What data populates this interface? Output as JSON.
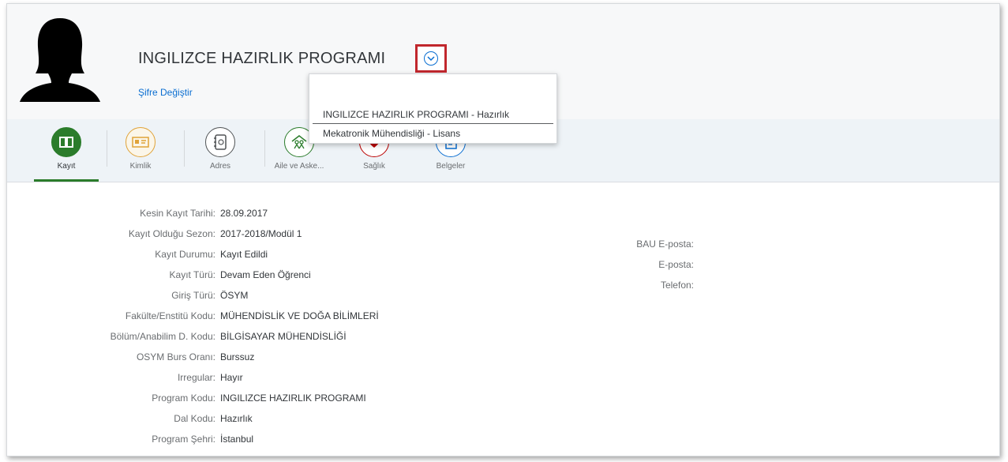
{
  "header": {
    "program_title": "INGILIZCE HAZIRLIK PROGRAMI",
    "change_password": "Şifre Değiştir"
  },
  "program_dropdown": {
    "items": [
      "INGILIZCE HAZIRLIK PROGRAMI - Hazırlık",
      "Mekatronik Mühendisliği - Lisans"
    ]
  },
  "tabs": [
    {
      "label": "Kayıt",
      "icon": "book-icon",
      "color": "#2b7c2b",
      "active": true
    },
    {
      "label": "Kimlik",
      "icon": "id-card-icon",
      "color": "#e0a339",
      "active": false
    },
    {
      "label": "Adres",
      "icon": "address-book-icon",
      "color": "#515456",
      "active": false
    },
    {
      "label": "Aile ve Aske...",
      "icon": "family-icon",
      "color": "#2b7c2b",
      "active": false
    },
    {
      "label": "Sağlık",
      "icon": "health-icon",
      "color": "#bb0000",
      "active": false
    },
    {
      "label": "Belgeler",
      "icon": "documents-icon",
      "color": "#0a6ed1",
      "active": false
    }
  ],
  "fields_left": [
    {
      "label": "Kesin Kayıt Tarihi:",
      "value": "28.09.2017"
    },
    {
      "label": "Kayıt Olduğu Sezon:",
      "value": "2017-2018/Modül 1"
    },
    {
      "label": "Kayıt Durumu:",
      "value": "Kayıt Edildi"
    },
    {
      "label": "Kayıt Türü:",
      "value": "Devam Eden Öğrenci"
    },
    {
      "label": "Giriş Türü:",
      "value": "ÖSYM"
    },
    {
      "label": "Fakülte/Enstitü Kodu:",
      "value": "MÜHENDİSLİK VE DOĞA BİLİMLERİ"
    },
    {
      "label": "Bölüm/Anabilim D. Kodu:",
      "value": "BİLGİSAYAR MÜHENDİSLİĞİ"
    },
    {
      "label": "OSYM Burs Oranı:",
      "value": "Burssuz"
    },
    {
      "label": "Irregular:",
      "value": "Hayır"
    },
    {
      "label": "Program Kodu:",
      "value": "INGILIZCE HAZIRLIK PROGRAMI"
    },
    {
      "label": "Dal Kodu:",
      "value": "Hazırlık"
    },
    {
      "label": "Program Şehri:",
      "value": "İstanbul"
    }
  ],
  "fields_right": [
    {
      "label": "BAU E-posta:",
      "value": ""
    },
    {
      "label": "E-posta:",
      "value": ""
    },
    {
      "label": "Telefon:",
      "value": ""
    }
  ]
}
